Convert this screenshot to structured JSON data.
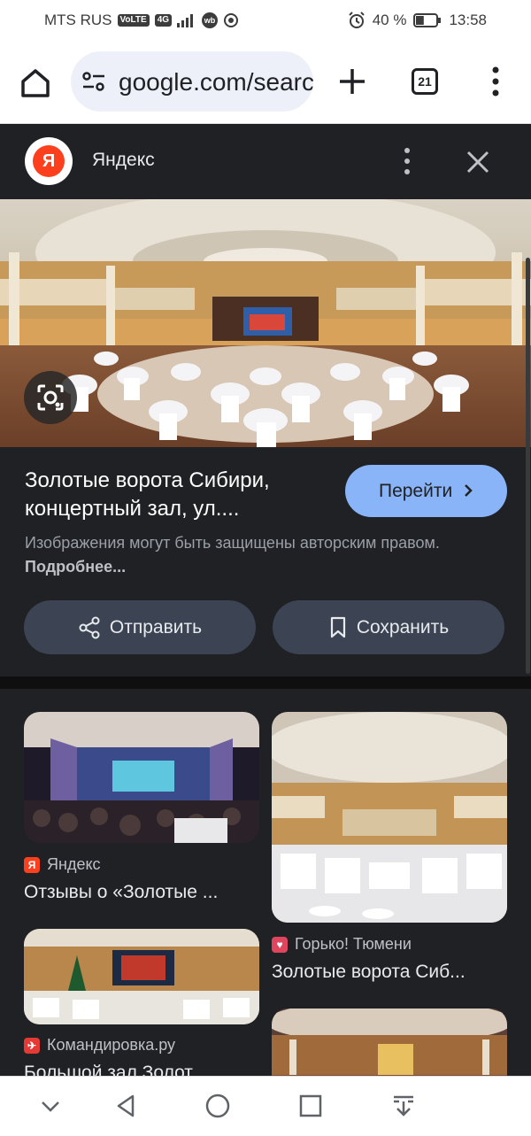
{
  "status_bar": {
    "carrier": "MTS RUS",
    "volte": "VoLTE",
    "network": "4G",
    "wb": "wb",
    "battery_percent": "40 %",
    "battery_level": 0.4,
    "time": "13:58",
    "icons": [
      "alarm-icon",
      "battery-icon",
      "signal-icon"
    ]
  },
  "browser": {
    "url": "google.com/search",
    "tab_count": "21",
    "icons": [
      "home-icon",
      "tune-icon",
      "plus-icon",
      "tabs-icon",
      "more-vert-icon"
    ]
  },
  "detail": {
    "source_logo": "Я",
    "source_name": "Яндекс",
    "title_line1": "Золотые ворота Сибири,",
    "title_line2": "концертный зал, ул....",
    "goto_label": "Перейти",
    "copyright_text": "Изображения могут быть защищены авторским правом.",
    "copyright_more": "Подробнее...",
    "share_label": "Отправить",
    "save_label": "Сохранить"
  },
  "related": [
    {
      "source": "Яндекс",
      "favicon": "Я",
      "favicon_color": "#fc3f1d",
      "title": "Отзывы о «Золотые ..."
    },
    {
      "source": "Горько! Тюмени",
      "favicon": "♥",
      "favicon_color": "#e0455e",
      "title": "Золотые ворота Сиб..."
    },
    {
      "source": "Командировка.ру",
      "favicon": "✈",
      "favicon_color": "#e53935",
      "title": "Большой зал Золот..."
    },
    {
      "source": "",
      "favicon": "",
      "favicon_color": "",
      "title": ""
    }
  ],
  "colors": {
    "accent": "#8ab4f8",
    "sheet_bg": "#202124",
    "action_bg": "#3c4453",
    "yandex_red": "#fc3f1d"
  }
}
